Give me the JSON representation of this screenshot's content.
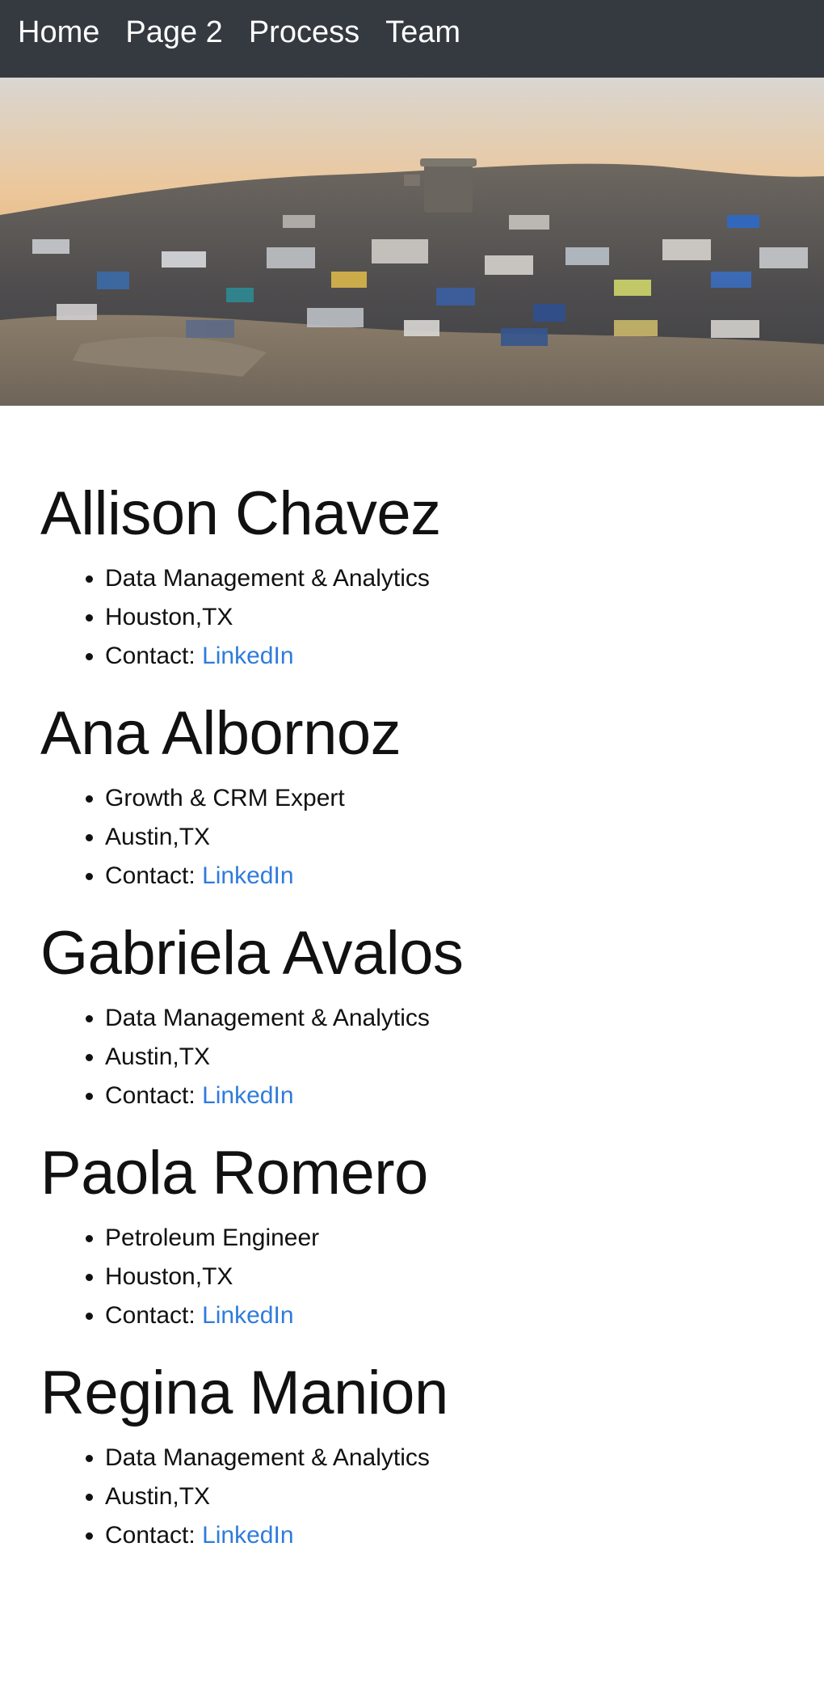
{
  "nav": {
    "items": [
      "Home",
      "Page 2",
      "Process",
      "Team"
    ],
    "background": "#343a40",
    "text_color": "#ffffff"
  },
  "hero": {
    "icon": "landfill-photo"
  },
  "members": [
    {
      "name": "Allison Chavez",
      "role": "Data Management & Analytics",
      "location": "Houston,TX",
      "contact_label": "Contact:",
      "link_text": "LinkedIn"
    },
    {
      "name": "Ana Albornoz",
      "role": "Growth & CRM Expert",
      "location": "Austin,TX",
      "contact_label": "Contact:",
      "link_text": "LinkedIn"
    },
    {
      "name": "Gabriela Avalos",
      "role": "Data Management & Analytics",
      "location": "Austin,TX",
      "contact_label": "Contact:",
      "link_text": "LinkedIn"
    },
    {
      "name": "Paola Romero",
      "role": "Petroleum Engineer",
      "location": "Houston,TX",
      "contact_label": "Contact:",
      "link_text": "LinkedIn"
    },
    {
      "name": "Regina Manion",
      "role": "Data Management & Analytics",
      "location": "Austin,TX",
      "contact_label": "Contact:",
      "link_text": "LinkedIn"
    }
  ],
  "colors": {
    "link": "#2f7bdc",
    "text": "#111111"
  }
}
